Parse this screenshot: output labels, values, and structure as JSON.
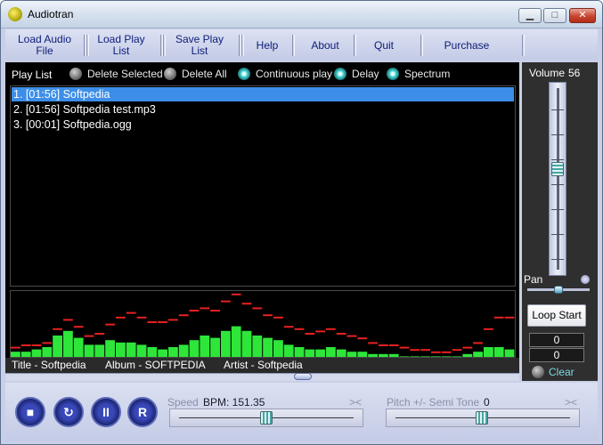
{
  "window": {
    "title": "Audiotran"
  },
  "menu": [
    {
      "label": "Load Audio\nFile"
    },
    {
      "label": "Load Play\nList"
    },
    {
      "label": "Save Play\nList"
    },
    {
      "label": "Help"
    },
    {
      "label": "About"
    },
    {
      "label": "Quit"
    },
    {
      "label": "Purchase"
    }
  ],
  "playlist_header": {
    "label": "Play List",
    "options": [
      {
        "label": "Delete Selected",
        "state": "off"
      },
      {
        "label": "Delete All",
        "state": "off"
      },
      {
        "label": "Continuous play",
        "state": "on"
      },
      {
        "label": "Delay",
        "state": "on"
      },
      {
        "label": "Spectrum",
        "state": "on"
      }
    ]
  },
  "playlist": {
    "items": [
      {
        "text": "1. [01:56] Softpedia",
        "selected": true
      },
      {
        "text": "2. [01:56] Softpedia test.mp3",
        "selected": false
      },
      {
        "text": "3. [00:01] Softpedia.ogg",
        "selected": false
      }
    ],
    "selected_color": "#3d8ee8"
  },
  "spectrum": {
    "bar_color": "#2ee63a",
    "peak_color": "#e82020",
    "levels": [
      3,
      3,
      4,
      5,
      10,
      12,
      9,
      6,
      6,
      8,
      7,
      7,
      6,
      5,
      4,
      5,
      6,
      8,
      10,
      9,
      12,
      14,
      12,
      10,
      9,
      8,
      6,
      5,
      4,
      4,
      5,
      4,
      3,
      3,
      2,
      2,
      2,
      1,
      1,
      1,
      1,
      1,
      1,
      2,
      3,
      5,
      5,
      4
    ],
    "peaks": [
      4,
      5,
      5,
      6,
      12,
      16,
      13,
      9,
      10,
      14,
      17,
      19,
      17,
      15,
      15,
      16,
      18,
      20,
      21,
      20,
      24,
      27,
      23,
      21,
      18,
      17,
      13,
      12,
      10,
      11,
      12,
      10,
      9,
      8,
      6,
      5,
      5,
      4,
      3,
      3,
      2,
      2,
      3,
      4,
      6,
      12,
      17,
      17
    ]
  },
  "track_info": {
    "title": "Title - Softpedia",
    "album": "Album - SOFTPEDIA",
    "artist": "Artist - Softpedia"
  },
  "volume": {
    "label": "Volume",
    "value": "56"
  },
  "pan": {
    "label": "Pan"
  },
  "loop_button": "Loop Start",
  "counters": [
    "0",
    "0"
  ],
  "clear_label": "Clear",
  "controls": [
    {
      "name": "stop",
      "glyph": "■"
    },
    {
      "name": "replay",
      "glyph": "↻"
    },
    {
      "name": "pause",
      "glyph": "II"
    },
    {
      "name": "reverse",
      "glyph": "R"
    }
  ],
  "speed": {
    "label": "Speed",
    "bpm_label": "BPM: 151.35",
    "reset": "><"
  },
  "pitch": {
    "label": "Pitch +/- Semi Tone",
    "value": "0",
    "reset": "><"
  }
}
